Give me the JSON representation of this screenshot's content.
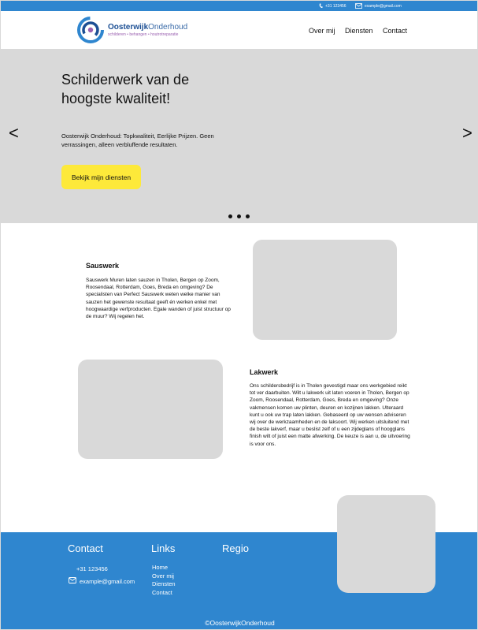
{
  "topbar": {
    "phone": "+31 123456",
    "email": "example@gmail.com"
  },
  "header": {
    "logo_name_bold": "Oosterwijk",
    "logo_name_light": "Onderhoud",
    "logo_tagline": "schilderen • behangen • houtrotreparatie",
    "nav": [
      "Over mij",
      "Diensten",
      "Contact"
    ]
  },
  "hero": {
    "title": "Schilderwerk van de hoogste kwaliteit!",
    "subtitle": "Oosterwijk Onderhoud: Topkwaliteit, Eerlijke Prijzen. Geen verrassingen, alleen verbluffende resultaten.",
    "button_label": "Bekijk mijn diensten",
    "prev_arrow": "<",
    "next_arrow": ">",
    "slide_count": 3
  },
  "sections": {
    "sauswerk": {
      "title": "Sauswerk",
      "body": "Sauswerk Muren laten sauzen in Tholen, Bergen op Zoom, Roosendaal, Rotterdam, Goes, Breda en omgeving?  De specialisten van Perfect Sauswerk weten welke manier van sauzen het gewenste resultaat geeft én werken enkel met hoogwaardige verfproducten. Egale wanden of juist structuur op de muur? Wij regelen het."
    },
    "lakwerk": {
      "title": "Lakwerk",
      "body": "Ons schildersbedrijf is in Tholen gevestigd maar ons werkgebied reikt tot ver daarbuiten. Wilt u lakwerk uit laten voeren in Tholen, Bergen op Zoom, Roosendaal, Rotterdam, Goes, Breda en omgeving? Onze vakmensen komen uw plinten, deuren en kozijnen lakken. Ulteraard kunt u ook uw trap laten lakken. Gebaseerd op uw wensen adviseren wij over de werkzaamheden en de laksoort. Wij werken uitsluitend met de beste lakverf, maar u beslist zelf of u een zijdeglans of hoogglans finish wilt of juist een matte afwerking. De keuze is aan u, de uitvoering is voor ons."
    }
  },
  "footer": {
    "contact_heading": "Contact",
    "links_heading": "Links",
    "region_heading": "Regio",
    "phone": "+31 123456",
    "email": "example@gmail.com",
    "links": [
      "Home",
      "Over mij",
      "Diensten",
      "Contact"
    ],
    "copyright": "©OosterwijkOnderhoud"
  },
  "colors": {
    "brand_blue": "#2f86cf",
    "accent_yellow": "#fde93a",
    "placeholder_gray": "#d9d9d9",
    "logo_navy": "#1c4f94",
    "logo_purple": "#9a60b0"
  },
  "icons": {
    "phone": "phone-icon",
    "email": "envelope-icon",
    "logo": "swirl-logo-icon"
  }
}
